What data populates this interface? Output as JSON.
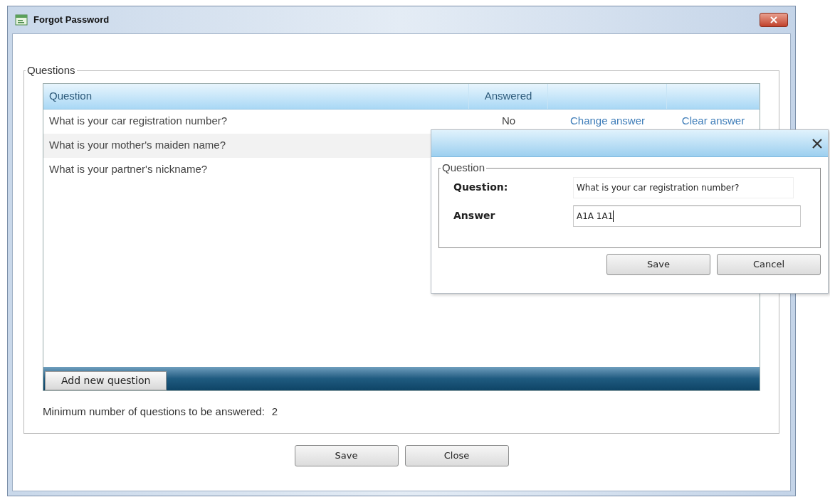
{
  "window": {
    "title": "Forgot Password"
  },
  "questions_group": {
    "legend": "Questions",
    "table": {
      "columns": [
        "Question",
        "Answered"
      ],
      "rows": [
        {
          "question": "What is your car registration number?",
          "answered": "No",
          "change_link": "Change answer",
          "clear_link": "Clear answer",
          "selected": false
        },
        {
          "question": "What is your mother's maiden name?",
          "selected": true
        },
        {
          "question": "What is your partner's nickname?",
          "selected": false
        }
      ]
    },
    "toolbar": {
      "add_button": "Add new question"
    },
    "minimum_label": "Minimum number of questions to be answered:",
    "minimum_value": "2"
  },
  "buttons": [
    "Save",
    "Close"
  ],
  "dialog": {
    "legend": "Question",
    "question_label": "Question:",
    "question_value": "What is your car registration number?",
    "answer_label": "Answer",
    "answer_value": "A1A 1A1",
    "buttons": [
      "Save",
      "Cancel"
    ]
  }
}
